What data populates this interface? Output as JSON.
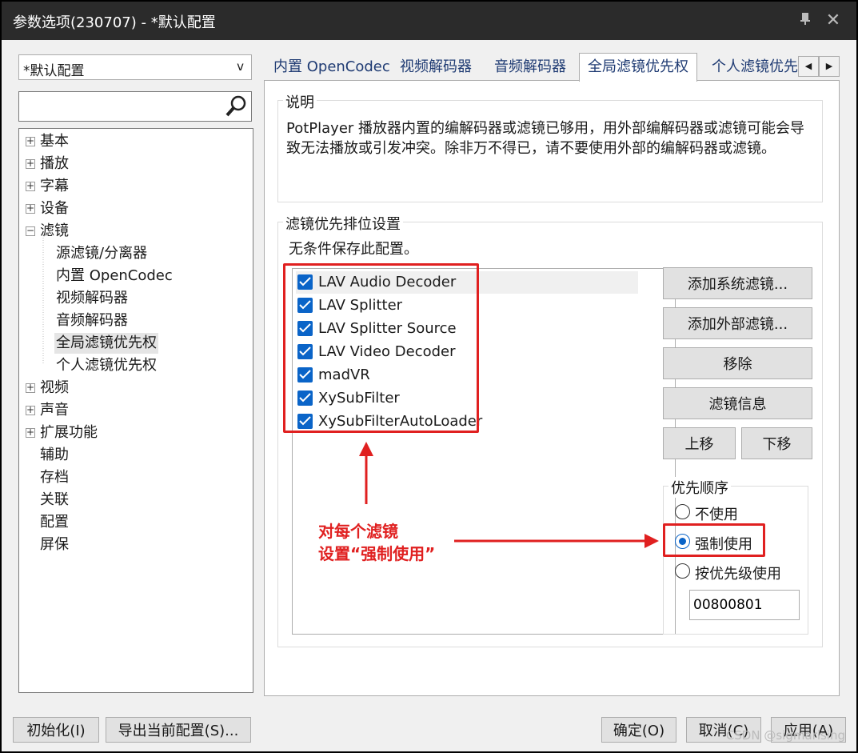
{
  "window": {
    "title": "参数选项(230707) - *默认配置"
  },
  "profile": {
    "value": "*默认配置",
    "arrow": "v"
  },
  "search": {
    "placeholder": ""
  },
  "tree": {
    "top_items": [
      "基本",
      "播放",
      "字幕",
      "设备"
    ],
    "filter_label": "滤镜",
    "filter_children": [
      "源滤镜/分离器",
      "内置 OpenCodec",
      "视频解码器",
      "音频解码器",
      "全局滤镜优先权",
      "个人滤镜优先权"
    ],
    "more_expandable": [
      "视频",
      "声音",
      "扩展功能"
    ],
    "leaf_items": [
      "辅助",
      "存档",
      "关联",
      "配置",
      "屏保"
    ]
  },
  "tabs": [
    "内置 OpenCodec",
    "视频解码器",
    "音频解码器",
    "全局滤镜优先权",
    "个人滤镜优先"
  ],
  "tab_scroll": {
    "left": "◀",
    "right": "▶"
  },
  "description": {
    "title": "说明",
    "text": "PotPlayer 播放器内置的编解码器或滤镜已够用，用外部编解码器或滤镜可能会导致无法播放或引发冲突。除非万不得已，请不要使用外部的编解码器或滤镜。"
  },
  "priority_settings": {
    "title": "滤镜优先排位设置",
    "subtitle": "无条件保存此配置。",
    "filters": [
      "LAV Audio Decoder",
      "LAV Splitter",
      "LAV Splitter Source",
      "LAV Video Decoder",
      "madVR",
      "XySubFilter",
      "XySubFilterAutoLoader"
    ],
    "buttons": {
      "add_system": "添加系统滤镜...",
      "add_external": "添加外部滤镜...",
      "remove": "移除",
      "info": "滤镜信息",
      "move_up": "上移",
      "move_down": "下移"
    },
    "priority_order": {
      "title": "优先顺序",
      "options": [
        "不使用",
        "强制使用",
        "按优先级使用"
      ],
      "selected": "强制使用",
      "value": "00800801"
    }
  },
  "annotation": {
    "line1": "对每个滤镜",
    "line2": "设置“强制使用”"
  },
  "bottom": {
    "init": "初始化(I)",
    "export": "导出当前配置(S)...",
    "ok": "确定(O)",
    "cancel": "取消(C)",
    "apply": "应用(A)"
  },
  "watermark": "CSDN @sigmarising",
  "colors": {
    "accent": "#0a64c8",
    "annotation": "#e02020",
    "titlebar": "#2b2b2b"
  }
}
